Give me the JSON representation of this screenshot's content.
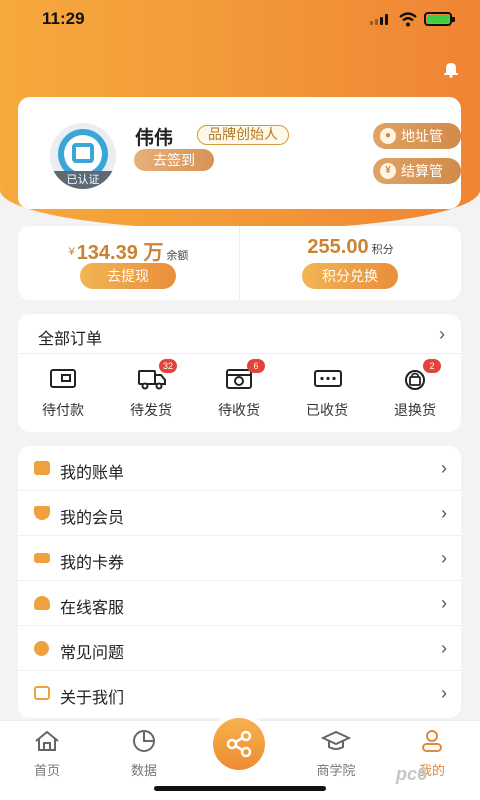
{
  "status_bar": {
    "time": "11:29"
  },
  "profile": {
    "name": "伟伟",
    "badge": "品牌创始人",
    "verified": "已认证",
    "checkin": "去签到",
    "address_btn": "地址管理",
    "settle_btn": "结算管理"
  },
  "wallet": {
    "balance_currency": "¥",
    "balance": "134.39 万",
    "balance_unit": "余额",
    "withdraw": "去提现",
    "points": "255.00",
    "points_unit": "积分",
    "exchange": "积分兑换"
  },
  "orders": {
    "title": "全部订单",
    "items": [
      {
        "label": "待付款",
        "icon": "wallet-icon",
        "badge": ""
      },
      {
        "label": "待发货",
        "icon": "truck-icon",
        "badge": "32"
      },
      {
        "label": "待收货",
        "icon": "box-clock-icon",
        "badge": "6"
      },
      {
        "label": "已收货",
        "icon": "chat-dots-icon",
        "badge": ""
      },
      {
        "label": "退换货",
        "icon": "bag-refund-icon",
        "badge": "2"
      }
    ]
  },
  "menu": {
    "items": [
      {
        "label": "我的账单",
        "icon": "bill-icon",
        "color": "#f0a03c"
      },
      {
        "label": "我的会员",
        "icon": "member-icon",
        "color": "#f0a03c"
      },
      {
        "label": "我的卡券",
        "icon": "coupon-icon",
        "color": "#f0a03c"
      },
      {
        "label": "在线客服",
        "icon": "headset-icon",
        "color": "#f0a03c"
      },
      {
        "label": "常见问题",
        "icon": "question-icon",
        "color": "#f0a03c"
      },
      {
        "label": "关于我们",
        "icon": "edit-icon",
        "color": "#f0a03c"
      }
    ]
  },
  "tabbar": {
    "items": [
      {
        "label": "首页",
        "icon": "home-icon"
      },
      {
        "label": "数据",
        "icon": "pie-chart-icon"
      },
      {
        "label": "商学院",
        "icon": "graduation-cap-icon"
      },
      {
        "label": "我的",
        "icon": "user-icon",
        "active": true
      }
    ],
    "center_icon": "share-icon"
  },
  "watermark": "pc6"
}
